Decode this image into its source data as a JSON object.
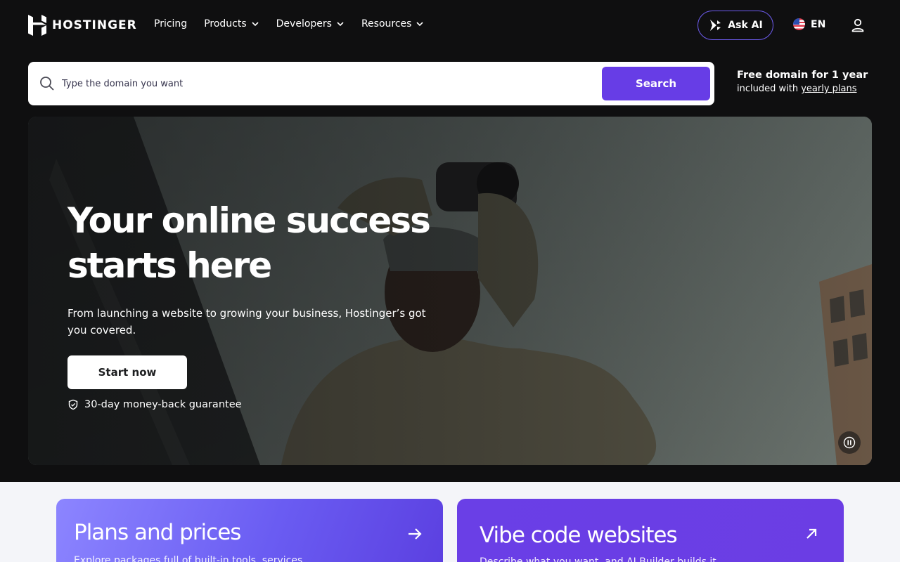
{
  "nav": {
    "brand": "HOSTINGER",
    "links": [
      {
        "label": "Pricing",
        "has_dropdown": false
      },
      {
        "label": "Products",
        "has_dropdown": true
      },
      {
        "label": "Developers",
        "has_dropdown": true
      },
      {
        "label": "Resources",
        "has_dropdown": true
      }
    ],
    "ask_ai_label": "Ask AI",
    "language": "EN",
    "icons": {
      "ask_ai": "sparkle-icon",
      "language": "us-flag-icon",
      "account": "user-icon"
    }
  },
  "search": {
    "placeholder": "Type the domain you want",
    "value": "",
    "button_label": "Search",
    "accent": "#673de6"
  },
  "promo": {
    "title": "Free domain for 1 year",
    "sub_prefix": "included with ",
    "sub_link": "yearly plans"
  },
  "hero": {
    "title": "Your online success starts here",
    "subtitle": "From launching a website to growing your business, Hostinger’s got you covered.",
    "cta_label": "Start now",
    "guarantee": "30-day money-back guarantee",
    "video_control": "pause-icon"
  },
  "cards": [
    {
      "title": "Plans and prices",
      "description": "Explore packages full of built-in tools, services",
      "icon": "arrow-right-icon"
    },
    {
      "title": "Vibe code websites",
      "description": "Describe what you want, and AI Builder builds it",
      "icon": "arrow-up-right-icon"
    }
  ],
  "colors": {
    "page_bg": "#0f0f10",
    "accent": "#673de6",
    "section_bg": "#f4f5f9"
  }
}
